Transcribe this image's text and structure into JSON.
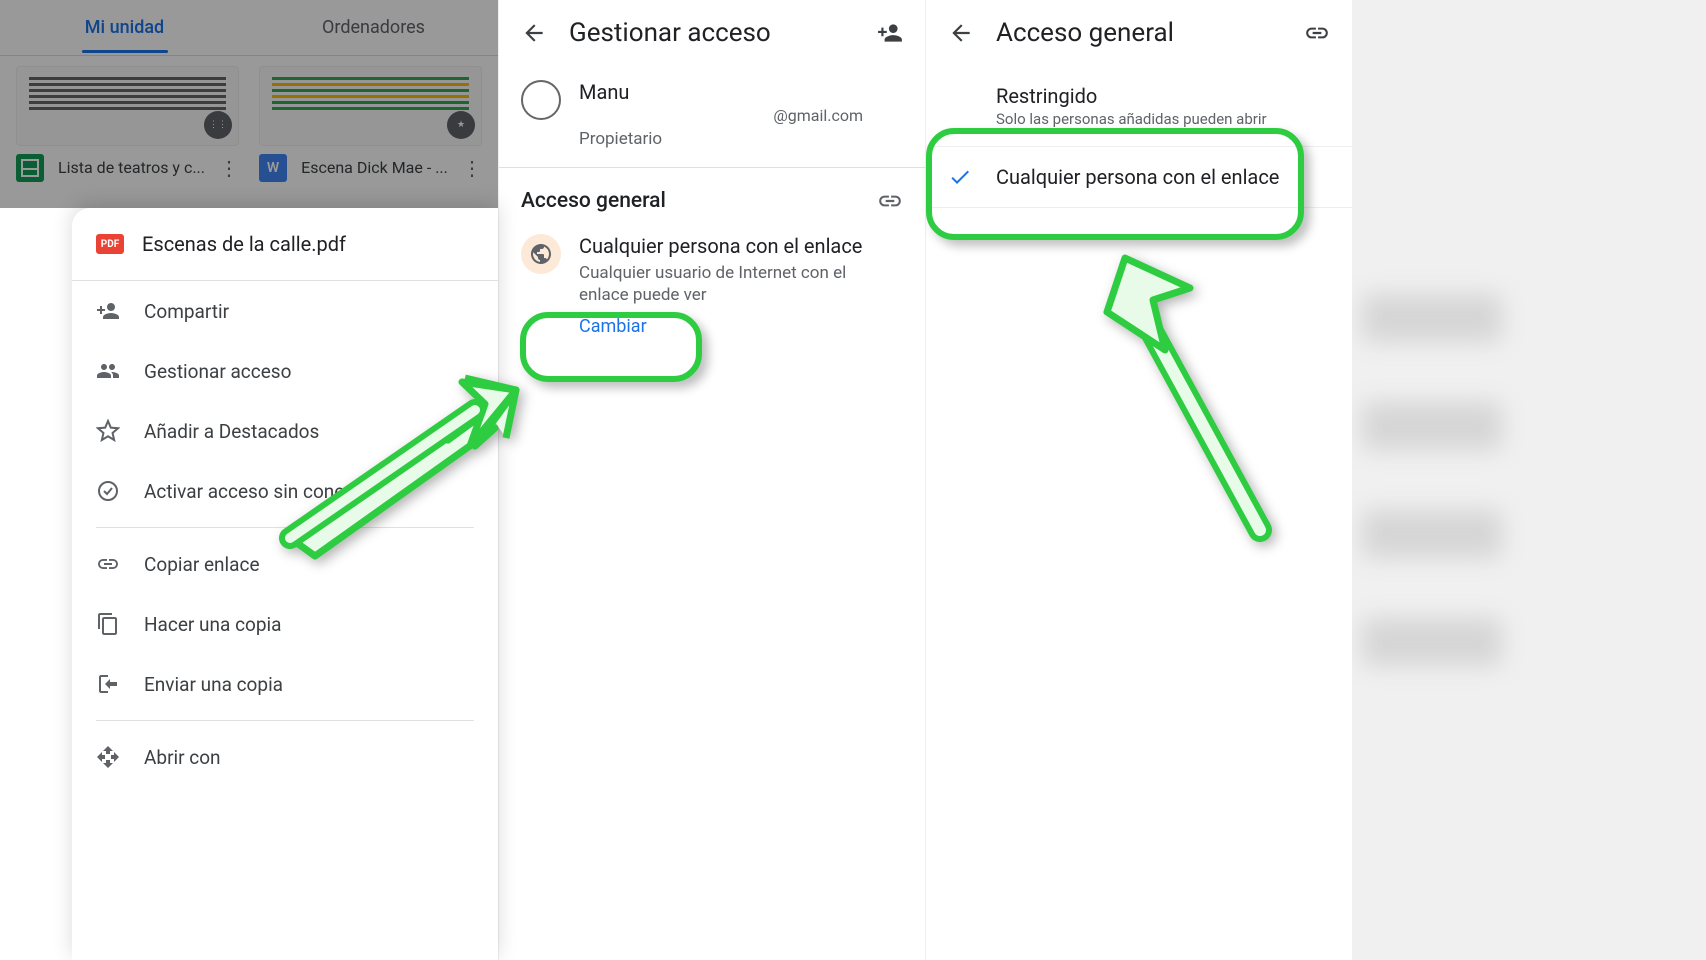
{
  "panel1": {
    "tabs": {
      "my_drive": "Mi unidad",
      "computers": "Ordenadores"
    },
    "files": [
      {
        "name": "Lista de teatros y c..."
      },
      {
        "name": "Escena Dick Mae - ..."
      }
    ],
    "word_glyph": "W",
    "sheet": {
      "file_title": "Escenas de la calle.pdf",
      "pdf_badge": "PDF",
      "menu": {
        "share": "Compartir",
        "manage": "Gestionar acceso",
        "star": "Añadir a Destacados",
        "offline": "Activar acceso sin conexión",
        "copy_link": "Copiar enlace",
        "make_copy": "Hacer una copia",
        "send_copy": "Enviar una copia",
        "open_with": "Abrir con"
      }
    }
  },
  "panel2": {
    "title": "Gestionar acceso",
    "person": {
      "name": "Manu",
      "email": "@gmail.com",
      "role": "Propietario"
    },
    "section_title": "Acceso general",
    "access": {
      "title": "Cualquier persona con el enlace",
      "desc": "Cualquier usuario de Internet con el enlace puede ver",
      "change": "Cambiar"
    }
  },
  "panel3": {
    "title": "Acceso general",
    "options": {
      "restricted": {
        "title": "Restringido",
        "desc": "Solo las personas añadidas pueden abrir"
      },
      "anyone": {
        "title": "Cualquier persona con el enlace"
      }
    }
  }
}
